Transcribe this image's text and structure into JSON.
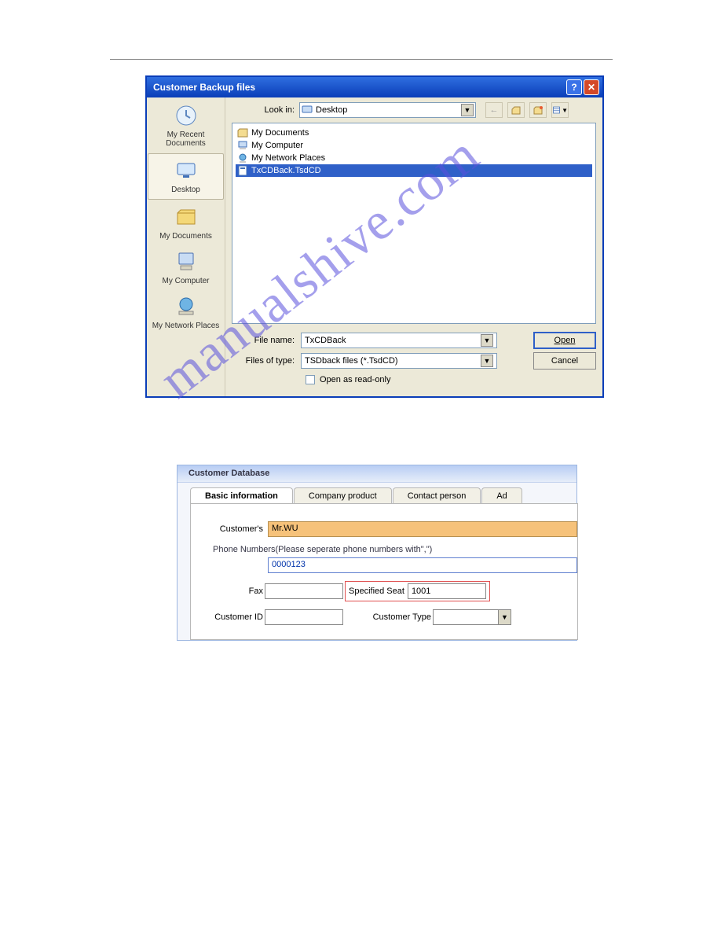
{
  "watermark": "manualshive.com",
  "dialog1": {
    "title": "Customer Backup files",
    "look_in_label": "Look in:",
    "look_in_value": "Desktop",
    "sidebar": [
      {
        "label": "My Recent Documents"
      },
      {
        "label": "Desktop"
      },
      {
        "label": "My Documents"
      },
      {
        "label": "My Computer"
      },
      {
        "label": "My Network Places"
      }
    ],
    "files": [
      {
        "name": "My Documents"
      },
      {
        "name": "My Computer"
      },
      {
        "name": "My Network Places"
      },
      {
        "name": "TxCDBack.TsdCD"
      }
    ],
    "filename_label": "File name:",
    "filename_value": "TxCDBack",
    "filetype_label": "Files of type:",
    "filetype_value": "TSDback files (*.TsdCD)",
    "readonly_label": "Open as read-only",
    "open_label": "Open",
    "cancel_label": "Cancel"
  },
  "dialog2": {
    "title": "Customer Database",
    "tabs": {
      "t1": "Basic information",
      "t2": "Company product",
      "t3": "Contact person",
      "t4": "Ad"
    },
    "customer_label": "Customer's",
    "customer_value": "Mr.WU",
    "phone_note": "Phone Numbers(Please seperate phone numbers with\",\")",
    "phone_value": "0000123",
    "fax_label": "Fax",
    "specseat_label": "Specified Seat",
    "specseat_value": "1001",
    "custid_label": "Customer ID",
    "custtype_label": "Customer Type"
  }
}
